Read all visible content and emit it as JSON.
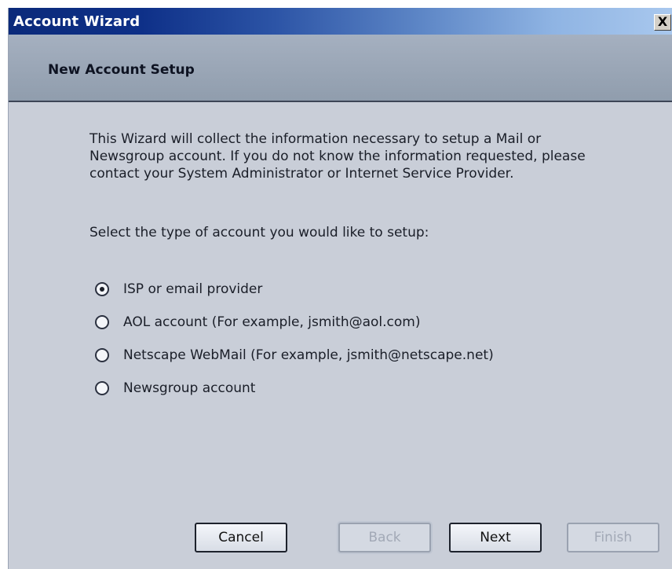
{
  "window": {
    "title": "Account Wizard",
    "close_label": "X"
  },
  "header": {
    "title": "New Account Setup"
  },
  "body": {
    "intro": "This Wizard will collect the information necessary to setup a Mail or Newsgroup account. If you do not know the information requested, please contact your System Administrator or Internet Service Provider.",
    "prompt": "Select the type of account you would like to setup:"
  },
  "options": [
    {
      "label": "ISP or email provider",
      "selected": true
    },
    {
      "label": "AOL account (For example, jsmith@aol.com)",
      "selected": false
    },
    {
      "label": "Netscape WebMail (For example, jsmith@netscape.net)",
      "selected": false
    },
    {
      "label": "Newsgroup account",
      "selected": false
    }
  ],
  "buttons": {
    "cancel": {
      "label": "Cancel",
      "enabled": true
    },
    "back": {
      "label": "Back",
      "enabled": false
    },
    "next": {
      "label": "Next",
      "enabled": true
    },
    "finish": {
      "label": "Finish",
      "enabled": false
    }
  },
  "colors": {
    "titlebar_dark": "#0b2a7a",
    "titlebar_light": "#a9c8ee",
    "dialog_bg": "#c9ced8",
    "header_band": "#a5b0c0"
  }
}
